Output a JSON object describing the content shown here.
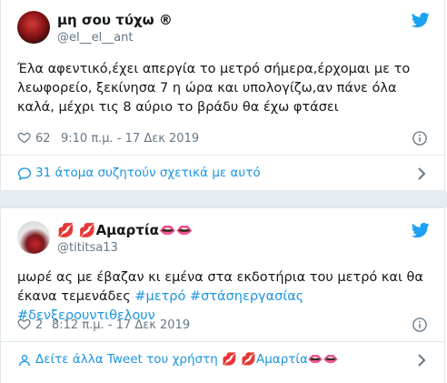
{
  "tweets": [
    {
      "name": "μη σου τύχω ®",
      "handle": "@el__el__ant",
      "avatar_icon": "profile-avatar",
      "text": "Έλα αφεντικό,έχει απεργία το μετρό σήμερα,έρχομαι με το λεωφορείο, ξεκίνησα 7 η ώρα και υπολογίζω,αν πάνε όλα καλά, μέχρι τις 8 αύριο το βράδυ θα έχω φτάσει",
      "likes": "62",
      "timestamp": "9:10 π.μ. - 17 Δεκ 2019",
      "footer": "31 άτομα συζητούν σχετικά με αυτό"
    },
    {
      "name": "💋 💋Αμαρτία👄👄",
      "handle": "@tititsa13",
      "avatar_icon": "profile-avatar",
      "text_plain": "μωρέ ας με έβαζαν κι εμένα στα εκδοτήρια του μετρό και θα έκανα τεμενάδες ",
      "hashtags": [
        "#μετρό",
        "#στάσηεργασίας",
        "#δενξερουντιθελουν"
      ],
      "likes": "2",
      "timestamp": "8:12 π.μ. - 17 Δεκ 2019",
      "footer": "Δείτε άλλα Tweet του χρήστη 💋 💋Αμαρτία👄👄"
    }
  ],
  "colors": {
    "accent": "#1b95e0",
    "twitter_bird": "#1da1f2",
    "muted": "#657786",
    "border": "#e1e8ed",
    "gap": "#e6ecf0"
  },
  "icons": [
    "twitter-bird-icon",
    "heart-icon",
    "info-icon",
    "comment-icon",
    "chevron-right-icon"
  ]
}
